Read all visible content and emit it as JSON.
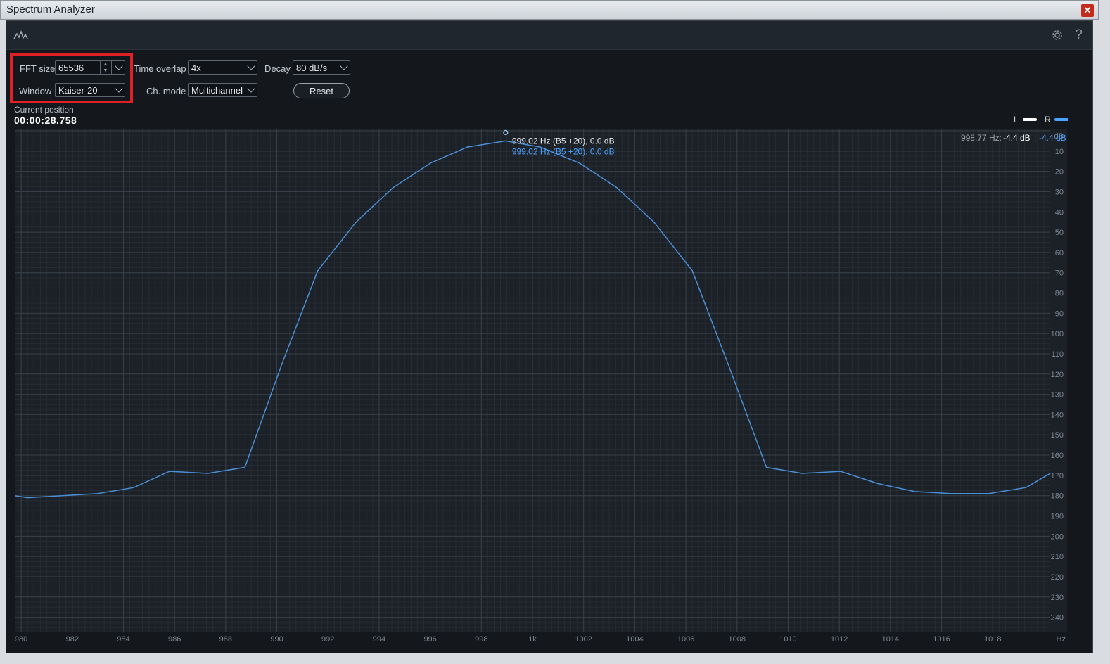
{
  "window": {
    "title": "Spectrum Analyzer",
    "close": "✕"
  },
  "toolbar": {
    "help": "?"
  },
  "controls": {
    "fft_label": "FFT size",
    "fft_value": "65536",
    "window_label": "Window",
    "window_value": "Kaiser-20",
    "overlap_label": "Time overlap",
    "overlap_value": "4x",
    "chmode_label": "Ch. mode",
    "chmode_value": "Multichannel",
    "decay_label": "Decay",
    "decay_value": "80 dB/s",
    "reset_label": "Reset"
  },
  "position": {
    "label": "Current position",
    "value": "00:00:28.758"
  },
  "legend": {
    "l": "L",
    "r": "R",
    "l_color": "#ffffff",
    "r_color": "#4aa3ff"
  },
  "readout": {
    "freq": "998.77 Hz:",
    "l_db": "-4.4 dB",
    "sep": "|",
    "r_db": "-4.4 dB"
  },
  "peak": {
    "line1": "999.02 Hz (B5 +20), 0.0 dB",
    "line2": "999.02 Hz (B5 +20), 0.0 dB"
  },
  "chart_data": {
    "type": "line",
    "xlabel": "Hz",
    "ylabel": "dB",
    "x_tick_labels": [
      "980",
      "982",
      "984",
      "986",
      "988",
      "990",
      "992",
      "994",
      "996",
      "998",
      "1k",
      "1002",
      "1004",
      "1006",
      "1008",
      "1010",
      "1012",
      "1014",
      "1016",
      "1018"
    ],
    "x_tick_values": [
      980,
      982,
      984,
      986,
      988,
      990,
      992,
      994,
      996,
      998,
      1000,
      1002,
      1004,
      1006,
      1008,
      1010,
      1012,
      1014,
      1016,
      1018
    ],
    "y_ticks": [
      10,
      20,
      30,
      40,
      50,
      60,
      70,
      80,
      90,
      100,
      110,
      120,
      130,
      140,
      150,
      160,
      170,
      180,
      190,
      200,
      210,
      220,
      230,
      240
    ],
    "xlim": [
      979.75,
      1020.25
    ],
    "ylim_dB": [
      0,
      -245
    ],
    "series": [
      {
        "color": "#4a8fd6",
        "x": [
          979.75,
          980.25,
          981.6,
          983.0,
          984.4,
          985.8,
          987.3,
          988.75,
          990.2,
          991.6,
          993.1,
          994.55,
          996.0,
          997.45,
          998.95,
          1000.3,
          1001.85,
          1003.3,
          1004.75,
          1006.25,
          1007.65,
          1009.15,
          1010.55,
          1012.05,
          1013.5,
          1014.95,
          1016.35,
          1017.85,
          1019.3,
          1020.25
        ],
        "y": [
          -180,
          -181,
          -180,
          -179,
          -176,
          -168,
          -169,
          -166,
          -115,
          -69,
          -45,
          -28,
          -16,
          -8,
          -5,
          -8,
          -16,
          -28,
          -45,
          -69,
          -115,
          -166,
          -169,
          -168,
          -174,
          -178,
          -179,
          -179,
          -176,
          -169
        ]
      }
    ]
  }
}
